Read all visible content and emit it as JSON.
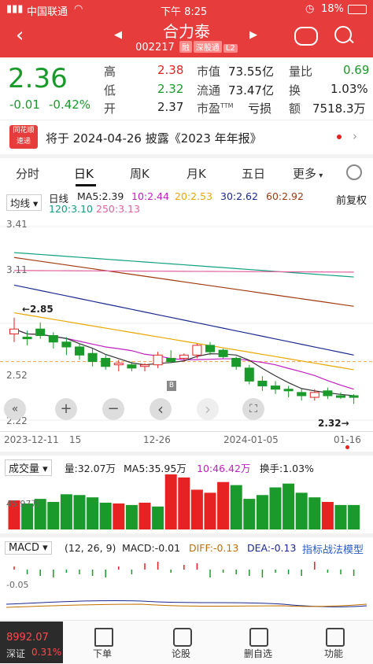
{
  "status_bar": {
    "carrier": "中国联通",
    "time": "下午 8:25",
    "battery": "18%"
  },
  "header": {
    "title": "合力泰",
    "code": "002217",
    "tags": [
      "融",
      "深股通",
      "L2"
    ]
  },
  "quote": {
    "price": "2.36",
    "change": "-0.01",
    "change_pct": "-0.42%",
    "high_label": "高",
    "high": "2.38",
    "low_label": "低",
    "low": "2.32",
    "open_label": "开",
    "open": "2.37",
    "mcap_label": "市值",
    "mcap": "73.55亿",
    "float_label": "流通",
    "float": "73.47亿",
    "pe_label": "市盈",
    "pe_sup": "TTM",
    "pe": "亏损",
    "vol_ratio_label": "量比",
    "vol_ratio": "0.69",
    "turnover_label": "换",
    "turnover": "1.03%",
    "amount_label": "额",
    "amount": "7518.3万"
  },
  "news": {
    "logo_top": "同花顺",
    "logo_bottom": "速递",
    "text": "将于 2024-04-26 披露《2023 年年报》"
  },
  "tabs": [
    {
      "label": "分时",
      "active": false
    },
    {
      "label": "日K",
      "active": true
    },
    {
      "label": "周K",
      "active": false
    },
    {
      "label": "月K",
      "active": false
    },
    {
      "label": "五日",
      "active": false
    },
    {
      "label": "更多",
      "active": false
    }
  ],
  "ma_legend": {
    "selector": "均线",
    "period": "日线",
    "items": [
      {
        "text": "MA5:2.39",
        "color": "#333333"
      },
      {
        "text": "10:2.44",
        "color": "#c020c0"
      },
      {
        "text": "20:2.53",
        "color": "#e8a800"
      },
      {
        "text": "30:2.62",
        "color": "#1a2a90"
      },
      {
        "text": "60:2.92",
        "color": "#a03a10"
      },
      {
        "text": "120:3.10",
        "color": "#10a080"
      },
      {
        "text": "250:3.13",
        "color": "#e060a0"
      }
    ],
    "adjust": "前复权"
  },
  "chart_data": [
    {
      "type": "candlestick",
      "title": "",
      "y_ticks": [
        "3.41",
        "3.11",
        "2.52",
        "2.22"
      ],
      "ylim": [
        2.22,
        3.41
      ],
      "x_labels": [
        "2023-12-11",
        "15",
        "12-26",
        "2024-01-05",
        "01-16"
      ],
      "annotations": [
        {
          "text": "←2.85"
        },
        {
          "text": "2.32→"
        }
      ],
      "candles": [
        {
          "o": 2.75,
          "h": 2.85,
          "l": 2.7,
          "c": 2.78
        },
        {
          "o": 2.73,
          "h": 2.77,
          "l": 2.68,
          "c": 2.72
        },
        {
          "o": 2.78,
          "h": 2.82,
          "l": 2.72,
          "c": 2.74
        },
        {
          "o": 2.74,
          "h": 2.76,
          "l": 2.66,
          "c": 2.7
        },
        {
          "o": 2.7,
          "h": 2.73,
          "l": 2.62,
          "c": 2.67
        },
        {
          "o": 2.67,
          "h": 2.69,
          "l": 2.59,
          "c": 2.62
        },
        {
          "o": 2.63,
          "h": 2.66,
          "l": 2.55,
          "c": 2.58
        },
        {
          "o": 2.6,
          "h": 2.62,
          "l": 2.53,
          "c": 2.55
        },
        {
          "o": 2.56,
          "h": 2.59,
          "l": 2.52,
          "c": 2.57
        },
        {
          "o": 2.56,
          "h": 2.58,
          "l": 2.52,
          "c": 2.54
        },
        {
          "o": 2.55,
          "h": 2.57,
          "l": 2.52,
          "c": 2.56
        },
        {
          "o": 2.56,
          "h": 2.64,
          "l": 2.54,
          "c": 2.62
        },
        {
          "o": 2.6,
          "h": 2.65,
          "l": 2.57,
          "c": 2.58
        },
        {
          "o": 2.6,
          "h": 2.63,
          "l": 2.58,
          "c": 2.62
        },
        {
          "o": 2.62,
          "h": 2.69,
          "l": 2.6,
          "c": 2.68
        },
        {
          "o": 2.68,
          "h": 2.7,
          "l": 2.62,
          "c": 2.64
        },
        {
          "o": 2.65,
          "h": 2.66,
          "l": 2.6,
          "c": 2.61
        },
        {
          "o": 2.6,
          "h": 2.61,
          "l": 2.53,
          "c": 2.55
        },
        {
          "o": 2.54,
          "h": 2.56,
          "l": 2.44,
          "c": 2.46
        },
        {
          "o": 2.46,
          "h": 2.49,
          "l": 2.4,
          "c": 2.43
        },
        {
          "o": 2.43,
          "h": 2.46,
          "l": 2.38,
          "c": 2.41
        },
        {
          "o": 2.41,
          "h": 2.43,
          "l": 2.36,
          "c": 2.4
        },
        {
          "o": 2.39,
          "h": 2.41,
          "l": 2.34,
          "c": 2.37
        },
        {
          "o": 2.36,
          "h": 2.41,
          "l": 2.34,
          "c": 2.39
        },
        {
          "o": 2.4,
          "h": 2.42,
          "l": 2.35,
          "c": 2.37
        },
        {
          "o": 2.37,
          "h": 2.39,
          "l": 2.35,
          "c": 2.36
        },
        {
          "o": 2.37,
          "h": 2.38,
          "l": 2.32,
          "c": 2.36
        }
      ]
    },
    {
      "type": "bar",
      "title": "成交量",
      "legend": [
        "量:32.07万",
        "MA5:35.95万",
        "10:46.42万",
        "换手:1.03%"
      ],
      "y_ticks": [
        "45.97万"
      ],
      "values": [
        38,
        34,
        40,
        36,
        46,
        45,
        42,
        35,
        34,
        32,
        35,
        30,
        72,
        68,
        52,
        48,
        62,
        58,
        40,
        45,
        55,
        60,
        48,
        42,
        36,
        32,
        32
      ],
      "colors": [
        "r",
        "g",
        "g",
        "g",
        "g",
        "g",
        "g",
        "g",
        "r",
        "g",
        "r",
        "g",
        "r",
        "r",
        "r",
        "r",
        "r",
        "g",
        "g",
        "g",
        "g",
        "g",
        "g",
        "g",
        "r",
        "g",
        "g"
      ]
    },
    {
      "type": "bar",
      "title": "MACD",
      "params": "(12, 26, 9)",
      "legend": [
        "MACD:-0.01",
        "DIFF:-0.13",
        "DEA:-0.13"
      ],
      "model_link": "指标战法模型",
      "y_ticks": [
        "-0.05"
      ]
    }
  ],
  "chart_controls": {
    "zoom_in": "+",
    "zoom_out": "−",
    "prev": "‹",
    "next": "›"
  },
  "bottom_bar": {
    "index_value": "8992.07",
    "index_name": "深证",
    "index_pct": "0.31%",
    "items": [
      {
        "label": "下单"
      },
      {
        "label": "论股"
      },
      {
        "label": "删自选"
      },
      {
        "label": "功能"
      }
    ]
  }
}
